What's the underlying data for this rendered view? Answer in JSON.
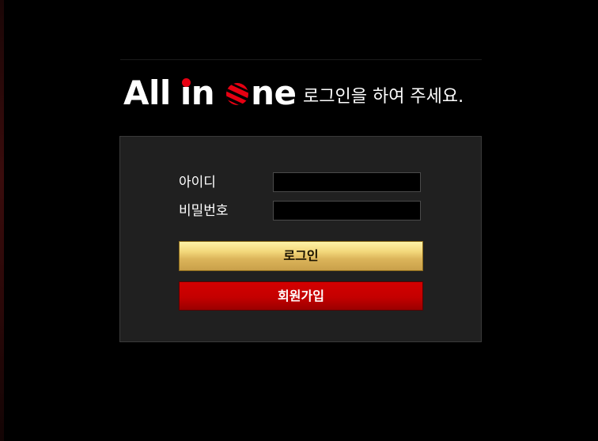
{
  "header": {
    "logo": {
      "text_all": "All",
      "text_in": "in",
      "text_ne": "ne",
      "full_text": "All in One",
      "accent_color": "#e60012"
    },
    "prompt": "로그인을 하여 주세요."
  },
  "login_form": {
    "id_label": "아이디",
    "id_value": "",
    "password_label": "비밀번호",
    "password_value": "",
    "login_button_label": "로그인",
    "signup_button_label": "회원가입"
  },
  "colors": {
    "background": "#000000",
    "panel": "#202020",
    "login_button": "#e8c46a",
    "signup_button": "#c40000"
  }
}
